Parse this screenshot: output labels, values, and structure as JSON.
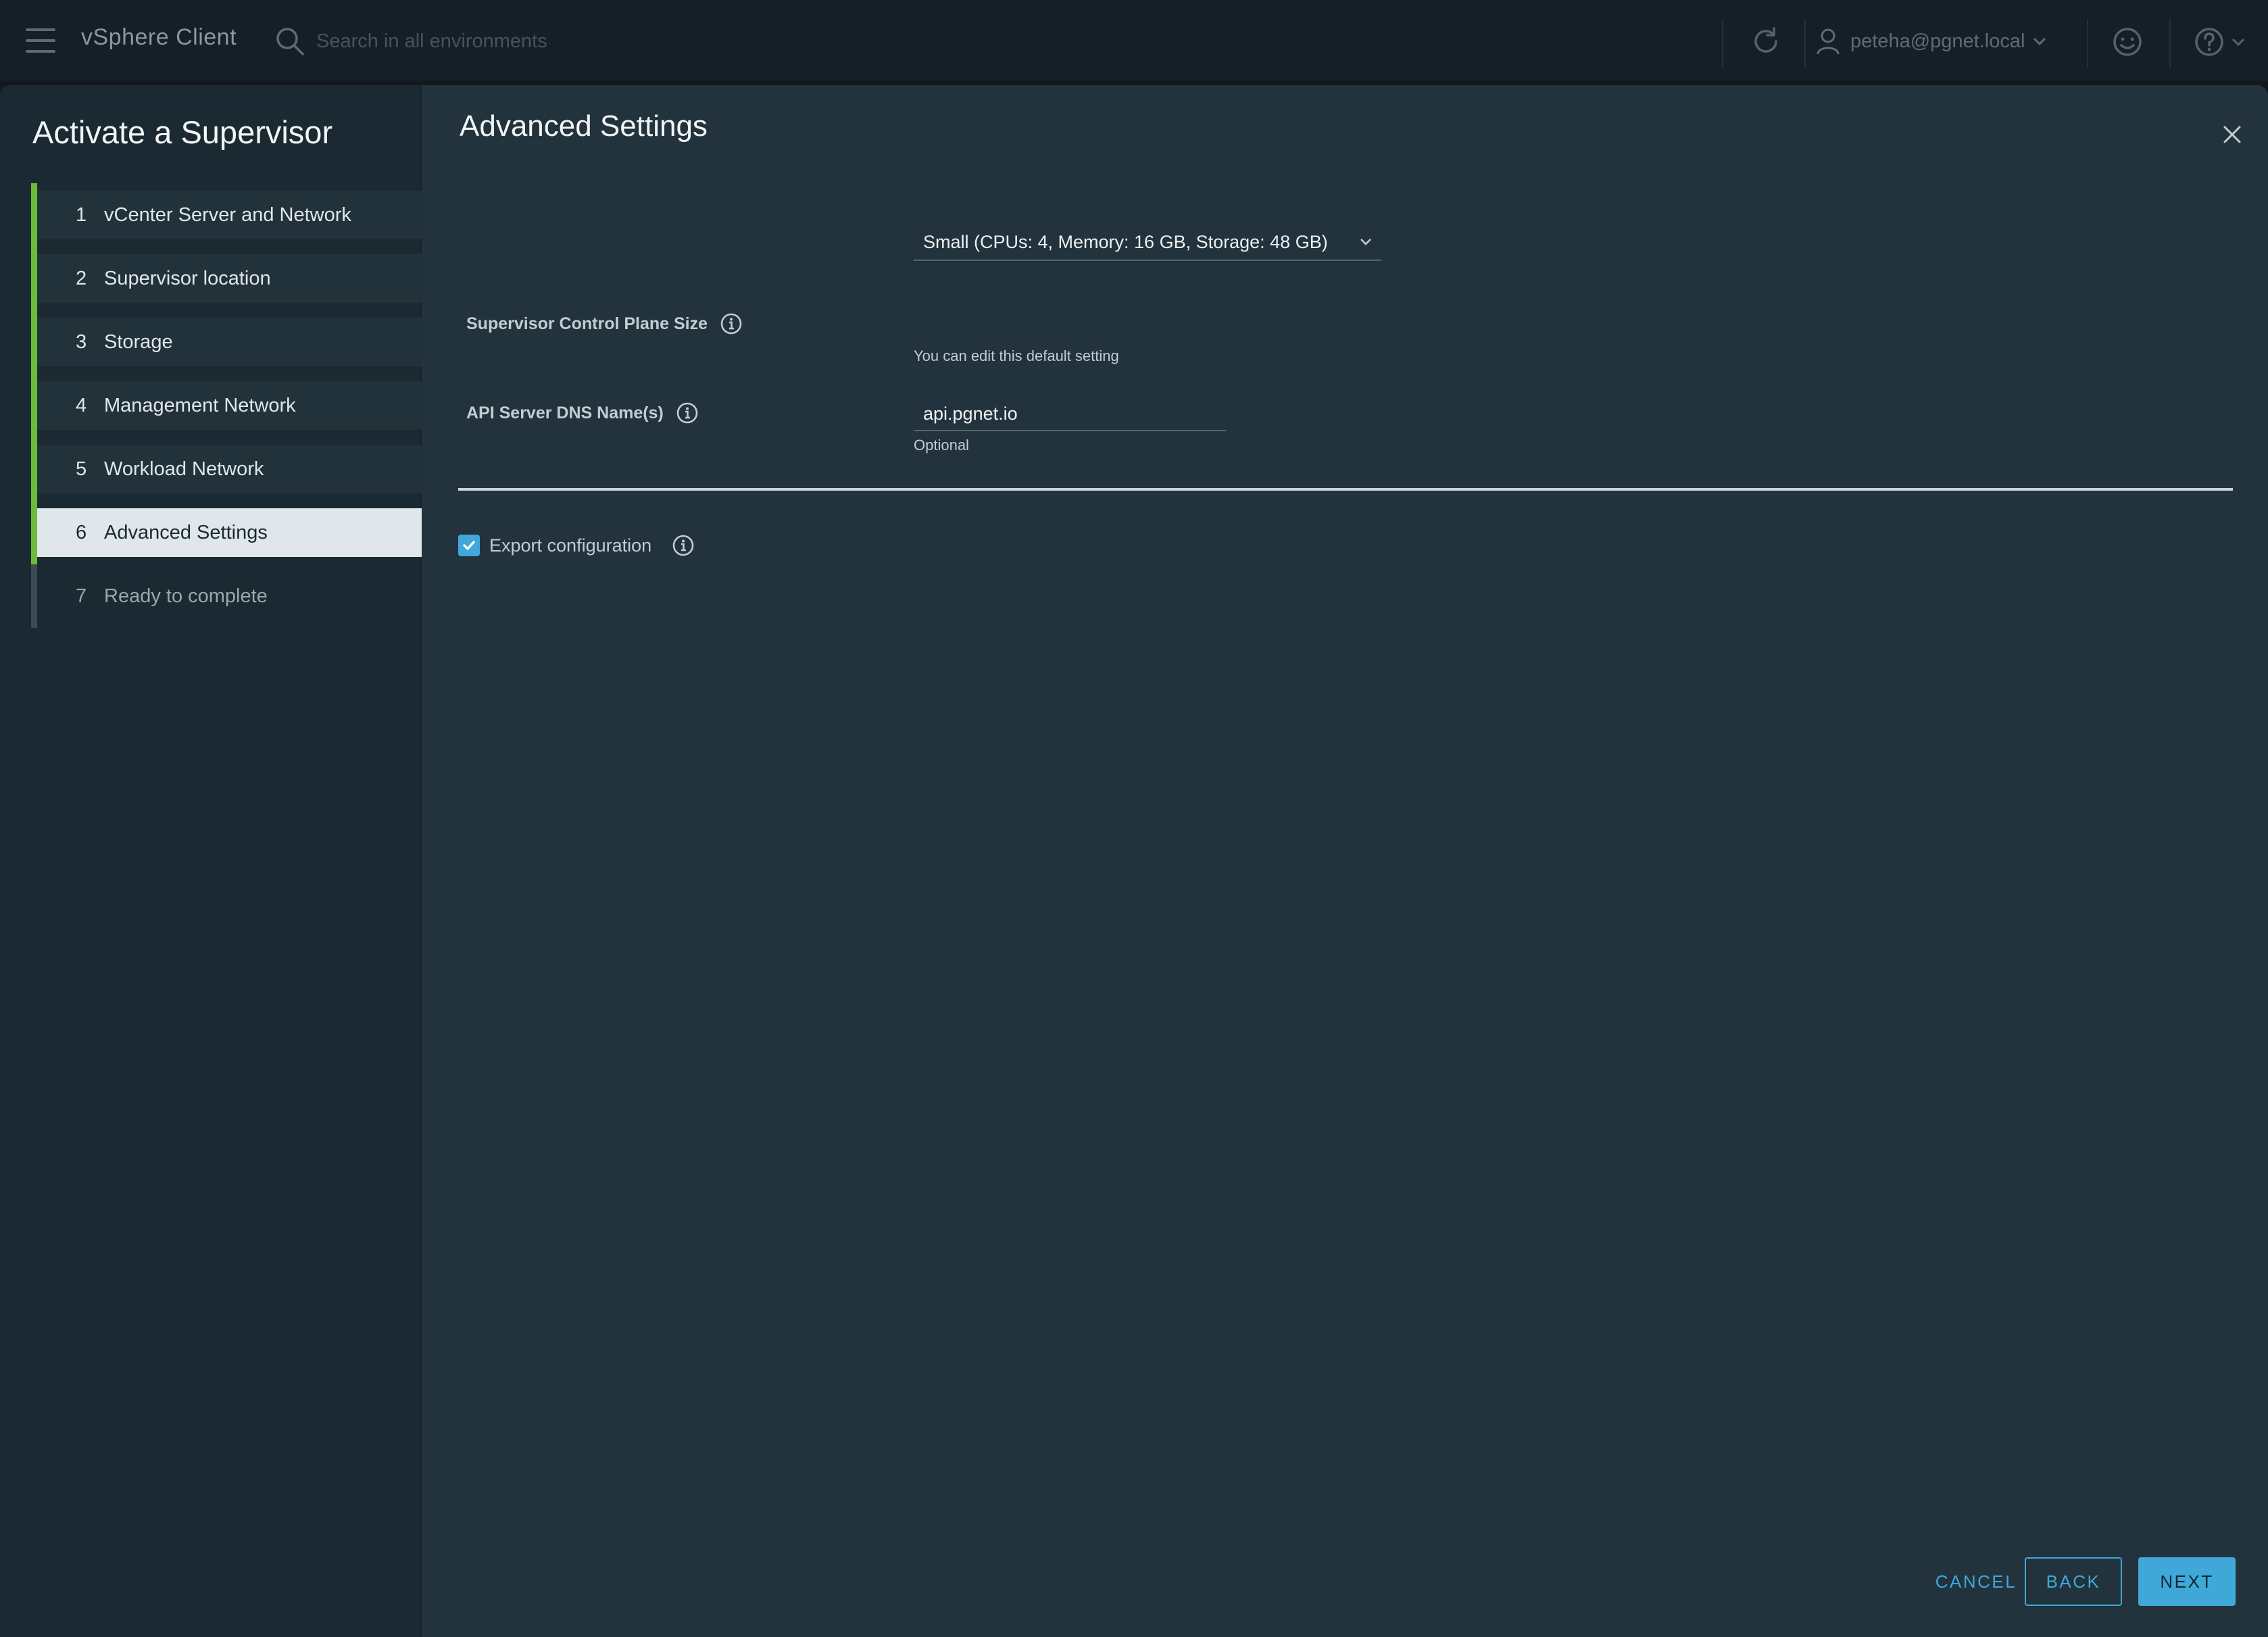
{
  "header": {
    "app_title": "vSphere Client",
    "search_placeholder": "Search in all environments",
    "user": "peteha@pgnet.local"
  },
  "wizard": {
    "title": "Activate a Supervisor",
    "steps": [
      {
        "num": "1",
        "label": "vCenter Server and Network",
        "state": "completed"
      },
      {
        "num": "2",
        "label": "Supervisor location",
        "state": "completed"
      },
      {
        "num": "3",
        "label": "Storage",
        "state": "completed"
      },
      {
        "num": "4",
        "label": "Management Network",
        "state": "completed"
      },
      {
        "num": "5",
        "label": "Workload Network",
        "state": "completed"
      },
      {
        "num": "6",
        "label": "Advanced Settings",
        "state": "active"
      },
      {
        "num": "7",
        "label": "Ready to complete",
        "state": "pending"
      }
    ],
    "section_title": "Advanced Settings",
    "fields": {
      "control_plane_size": {
        "label": "Supervisor Control Plane Size",
        "value": "Small (CPUs: 4, Memory: 16 GB, Storage: 48 GB)",
        "helper": "You can edit this default setting"
      },
      "api_dns": {
        "label": "API Server DNS Name(s)",
        "value": "api.pgnet.io",
        "helper": "Optional"
      }
    },
    "export_config": {
      "label": "Export configuration",
      "checked": true
    },
    "buttons": {
      "cancel": "CANCEL",
      "back": "BACK",
      "next": "NEXT"
    }
  },
  "colors": {
    "accent": "#3fa8d8",
    "step_done": "#6cbb3c",
    "panel_bg": "#22333d",
    "nav_bg": "#1b2a32"
  },
  "icons": [
    "menu-icon",
    "search-icon",
    "refresh-icon",
    "user-icon",
    "chevron-down-icon",
    "smiley-icon",
    "help-icon",
    "close-icon",
    "info-icon",
    "checkmark-icon"
  ]
}
